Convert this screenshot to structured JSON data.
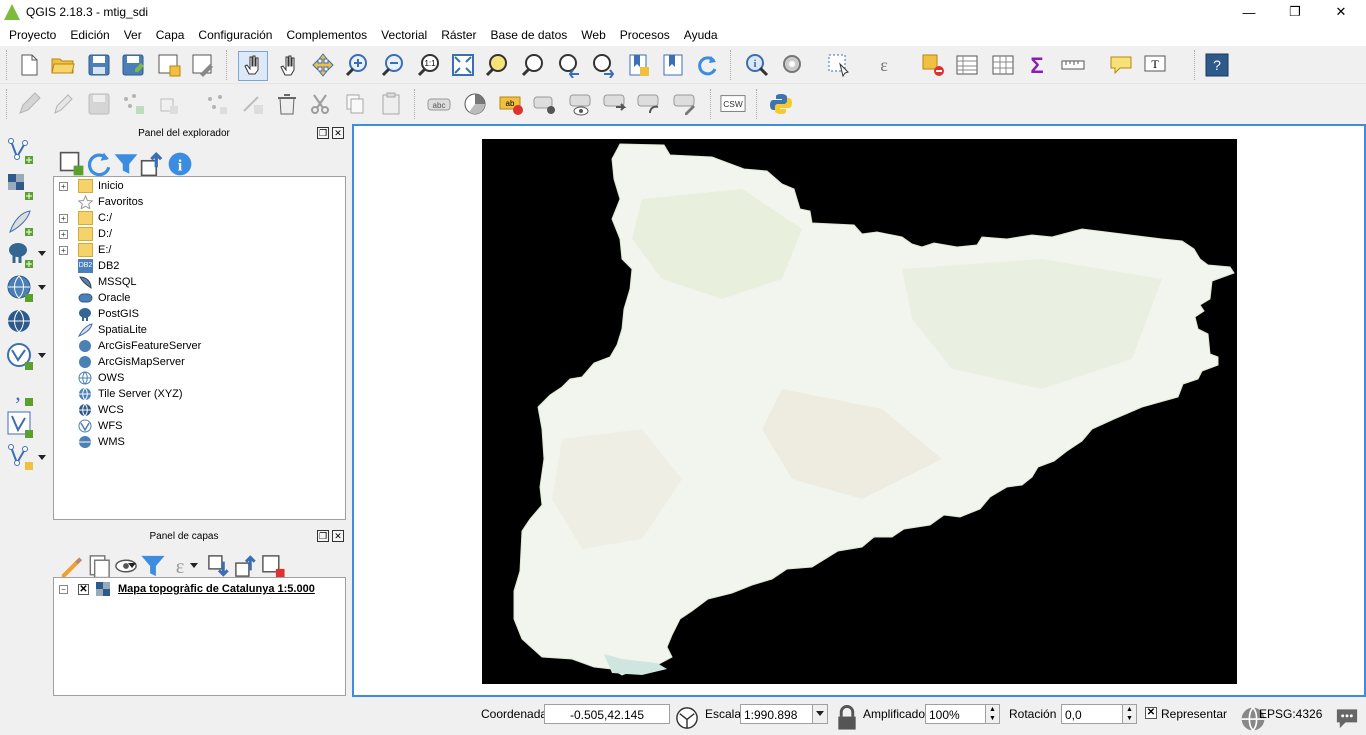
{
  "window": {
    "title": "QGIS 2.18.3 - mtig_sdi",
    "minimize": "—",
    "maximize": "❐",
    "close": "✕"
  },
  "menu": [
    "Proyecto",
    "Edición",
    "Ver",
    "Capa",
    "Configuración",
    "Complementos",
    "Vectorial",
    "Ráster",
    "Base de datos",
    "Web",
    "Procesos",
    "Ayuda"
  ],
  "toolbar2": {
    "csw_label": "CSW",
    "label_tool": "abc",
    "label_tool_active": "ab"
  },
  "browser": {
    "title": "Panel del explorador",
    "items": [
      {
        "label": "Inicio",
        "icon": "folder-icon",
        "expandable": true
      },
      {
        "label": "Favoritos",
        "icon": "star-icon",
        "expandable": false
      },
      {
        "label": "C:/",
        "icon": "folder-icon",
        "expandable": true
      },
      {
        "label": "D:/",
        "icon": "folder-icon",
        "expandable": true
      },
      {
        "label": "E:/",
        "icon": "folder-icon",
        "expandable": true
      },
      {
        "label": "DB2",
        "icon": "db2-icon",
        "expandable": false
      },
      {
        "label": "MSSQL",
        "icon": "mssql-icon",
        "expandable": false
      },
      {
        "label": "Oracle",
        "icon": "oracle-icon",
        "expandable": false
      },
      {
        "label": "PostGIS",
        "icon": "postgis-elephant-icon",
        "expandable": false
      },
      {
        "label": "SpatiaLite",
        "icon": "spatialite-feather-icon",
        "expandable": false
      },
      {
        "label": "ArcGisFeatureServer",
        "icon": "arcgis-globe-icon",
        "expandable": false
      },
      {
        "label": "ArcGisMapServer",
        "icon": "arcgis-globe-icon",
        "expandable": false
      },
      {
        "label": "OWS",
        "icon": "ows-globe-icon",
        "expandable": false
      },
      {
        "label": "Tile Server (XYZ)",
        "icon": "xyz-globe-icon",
        "expandable": false
      },
      {
        "label": "WCS",
        "icon": "wcs-globe-icon",
        "expandable": false
      },
      {
        "label": "WFS",
        "icon": "wfs-globe-icon",
        "expandable": false
      },
      {
        "label": "WMS",
        "icon": "wms-globe-icon",
        "expandable": false
      }
    ],
    "db2_badge": "DB2"
  },
  "layers_panel": {
    "title": "Panel de capas",
    "layers": [
      {
        "label": "Mapa topogràfic de Catalunya 1:5.000",
        "checked": true
      }
    ]
  },
  "statusbar": {
    "coord_label": "Coordenada",
    "coord_value": "-0.505,42.145",
    "scale_label": "Escala",
    "scale_value": "1:990.898",
    "magnifier_label": "Amplificador",
    "magnifier_value": "100%",
    "rotation_label": "Rotación",
    "rotation_value": "0,0",
    "render_label": "Representar",
    "crs_label": "EPSG:4326"
  },
  "colors": {
    "accent": "#3c8de0",
    "map_background": "#000000",
    "map_land": "#f2f5ee"
  }
}
